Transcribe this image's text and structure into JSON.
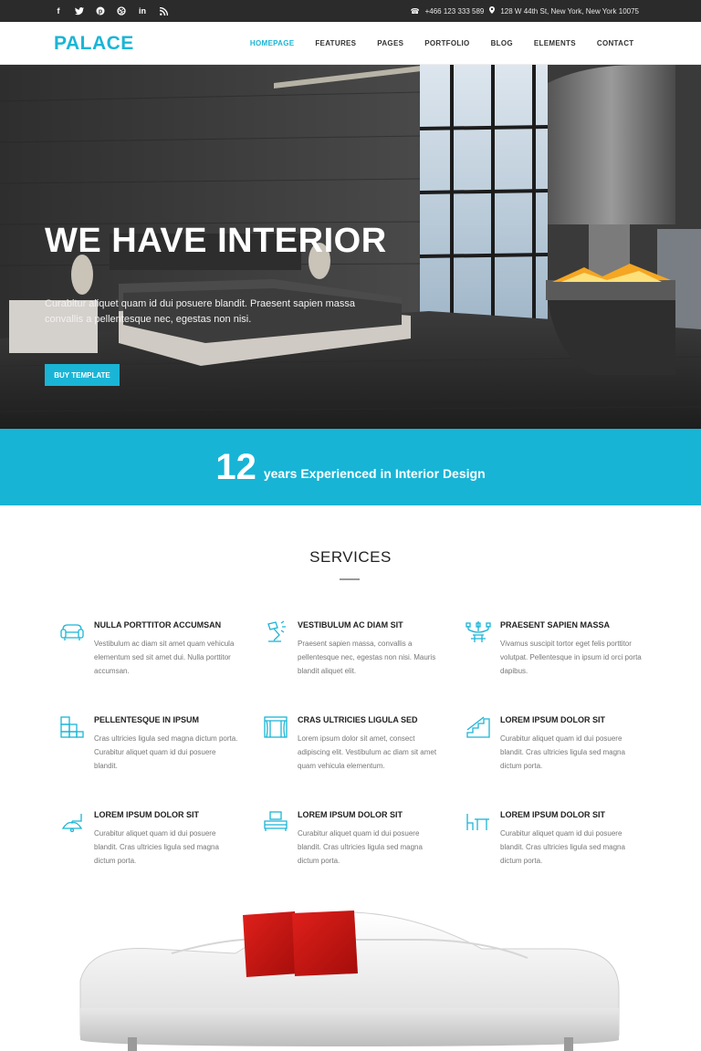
{
  "topbar": {
    "social_icons": [
      "facebook-icon",
      "twitter-icon",
      "pinterest-icon",
      "dribbble-icon",
      "linkedin-icon",
      "rss-icon"
    ],
    "phone": "+466 123 333 589",
    "address": "128 W 44th St, New York, New York 10075"
  },
  "header": {
    "logo": "PALACE",
    "nav": [
      "HOMEPAGE",
      "FEATURES",
      "PAGES",
      "PORTFOLIO",
      "BLOG",
      "ELEMENTS",
      "CONTACT"
    ],
    "active_nav": "HOMEPAGE"
  },
  "hero": {
    "title": "WE HAVE INTERIOR",
    "text": "Curabitur aliquet quam id dui posuere blandit. Praesent sapien massa convallis a pellentesque nec, egestas non nisi.",
    "button": "BUY TEMPLATE"
  },
  "band": {
    "number": "12",
    "text": "years Experienced in Interior Design"
  },
  "services": {
    "title": "SERVICES",
    "items": [
      {
        "icon": "sofa-icon",
        "name": "NULLA PORTTITOR ACCUMSAN",
        "desc": "Vestibulum ac diam sit amet quam vehicula elementum sed sit amet dui. Nulla porttitor accumsan."
      },
      {
        "icon": "desk-lamp-icon",
        "name": "VESTIBULUM AC DIAM SIT",
        "desc": "Praesent sapien massa, convallis a pellentesque nec, egestas non nisi. Mauris blandit aliquet elit."
      },
      {
        "icon": "chandelier-icon",
        "name": "PRAESENT SAPIEN MASSA",
        "desc": "Vivamus suscipit tortor eget felis porttitor volutpat. Pellentesque in ipsum id orci porta dapibus."
      },
      {
        "icon": "shelves-icon",
        "name": "PELLENTESQUE IN IPSUM",
        "desc": "Cras ultricies ligula sed magna dictum porta. Curabitur aliquet quam id dui posuere blandit."
      },
      {
        "icon": "window-icon",
        "name": "CRAS ULTRICIES LIGULA SED",
        "desc": "Lorem ipsum dolor sit amet, consect adipiscing elit. Vestibulum ac diam sit amet quam vehicula elementum."
      },
      {
        "icon": "stairs-icon",
        "name": "LOREM IPSUM DOLOR SIT",
        "desc": "Curabitur aliquet quam id dui posuere blandit. Cras ultricies ligula sed magna dictum porta."
      },
      {
        "icon": "wall-lamp-icon",
        "name": "LOREM IPSUM DOLOR SIT",
        "desc": "Curabitur aliquet quam id dui posuere blandit. Cras ultricies ligula sed magna dictum porta."
      },
      {
        "icon": "bed-icon",
        "name": "LOREM IPSUM DOLOR SIT",
        "desc": "Curabitur aliquet quam id dui posuere blandit. Cras ultricies ligula sed magna dictum porta."
      },
      {
        "icon": "table-chair-icon",
        "name": "LOREM IPSUM DOLOR SIT",
        "desc": "Curabitur aliquet quam id dui posuere blandit. Cras ultricies ligula sed magna dictum porta."
      }
    ]
  },
  "colors": {
    "accent": "#1ab5d6",
    "topbar": "#2b2b2b",
    "band": "#17b4d6"
  }
}
